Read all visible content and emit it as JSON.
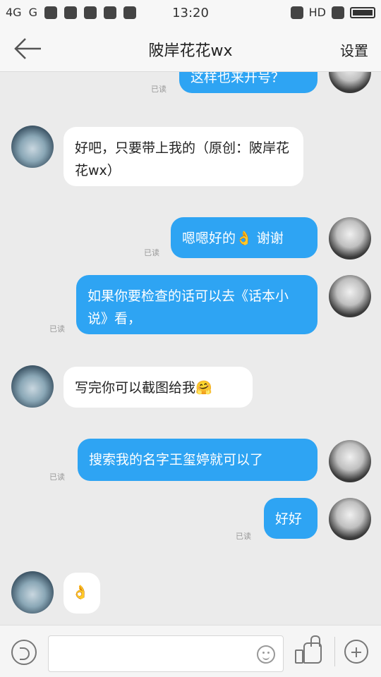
{
  "status_bar": {
    "network_1": "4G",
    "network_2": "G",
    "time": "13:20",
    "hd": "HD"
  },
  "header": {
    "title": "陂岸花花wx",
    "settings_label": "设置"
  },
  "chat": {
    "messages": [
      {
        "side": "right",
        "text": "这样也来开号？",
        "read": "已读"
      },
      {
        "side": "left",
        "text": "好吧，只要带上我的（原创：陂岸花花wx）"
      },
      {
        "side": "right",
        "text": "嗯嗯好的👌 谢谢",
        "read": "已读"
      },
      {
        "side": "right",
        "text": "如果你要检查的话可以去《话本小说》看，",
        "read": "已读"
      },
      {
        "side": "left",
        "text": "写完你可以截图给我🤗"
      },
      {
        "side": "right",
        "text": "搜索我的名字王玺婷就可以了",
        "read": "已读"
      },
      {
        "side": "right",
        "text": "好好",
        "read": "已读"
      },
      {
        "side": "left",
        "text": "👌"
      }
    ]
  },
  "input_bar": {
    "placeholder": ""
  },
  "icons": {
    "back": "back-arrow-icon",
    "voice": "voice-icon",
    "emoji": "emoji-icon",
    "like": "thumbs-up-icon",
    "plus": "plus-icon"
  },
  "colors": {
    "bubble_right": "#2ea4f3",
    "bubble_left": "#ffffff",
    "background": "#ebebeb"
  }
}
